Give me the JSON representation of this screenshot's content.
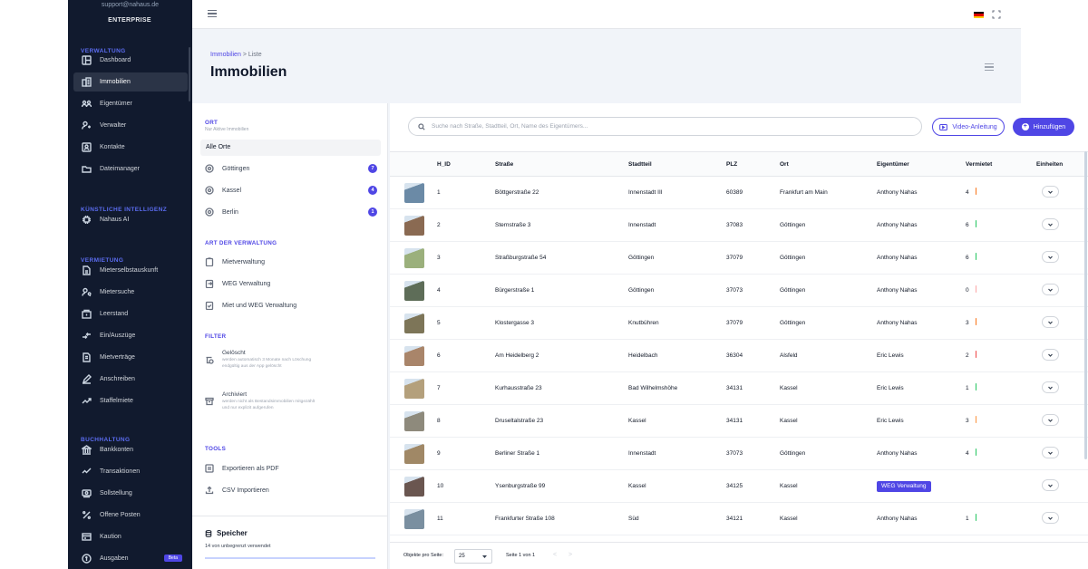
{
  "sidebar": {
    "email": "support@nahaus.de",
    "plan": "ENTERPRISE",
    "sections": [
      {
        "key": "verwaltung",
        "label": "VERWALTUNG"
      },
      {
        "key": "ki",
        "label": "KÜNSTLICHE INTELLIGENZ"
      },
      {
        "key": "vermietung",
        "label": "VERMIETUNG"
      },
      {
        "key": "buchhaltung",
        "label": "BUCHHALTUNG"
      }
    ],
    "items": [
      {
        "label": "Dashboard",
        "icon": "dashboard-icon"
      },
      {
        "label": "Immobilien",
        "icon": "building-icon",
        "active": true
      },
      {
        "label": "Eigentümer",
        "icon": "owners-icon"
      },
      {
        "label": "Verwalter",
        "icon": "managers-icon"
      },
      {
        "label": "Kontakte",
        "icon": "contacts-icon"
      },
      {
        "label": "Dateimanager",
        "icon": "folder-icon"
      },
      {
        "label": "Nahaus AI",
        "icon": "ai-chip-icon"
      },
      {
        "label": "Mieterselbstauskunft",
        "icon": "document-icon"
      },
      {
        "label": "Mietersuche",
        "icon": "tenant-search-icon"
      },
      {
        "label": "Leerstand",
        "icon": "vacancy-icon"
      },
      {
        "label": "Ein/Auszüge",
        "icon": "move-icon"
      },
      {
        "label": "Mietverträge",
        "icon": "contract-icon"
      },
      {
        "label": "Anschreiben",
        "icon": "pen-icon"
      },
      {
        "label": "Staffelmiete",
        "icon": "trend-icon"
      },
      {
        "label": "Bankkonten",
        "icon": "bank-icon"
      },
      {
        "label": "Transaktionen",
        "icon": "transactions-icon"
      },
      {
        "label": "Sollstellung",
        "icon": "cash-icon"
      },
      {
        "label": "Offene Posten",
        "icon": "percent-icon"
      },
      {
        "label": "Kaution",
        "icon": "deposit-icon"
      },
      {
        "label": "Ausgaben",
        "icon": "expenses-icon",
        "badge": "Beta"
      }
    ]
  },
  "topbar": {
    "language": "de"
  },
  "header": {
    "breadcrumb_root": "Immobilien",
    "breadcrumb_sep": ">",
    "breadcrumb_current": "Liste",
    "title": "Immobilien"
  },
  "filters": {
    "ort_title": "ORT",
    "ort_sub": "Nur Aktive Immobilien",
    "all_locations": "Alle Orte",
    "locations": [
      {
        "name": "Göttingen",
        "count": "7"
      },
      {
        "name": "Kassel",
        "count": "4"
      },
      {
        "name": "Berlin",
        "count": "1"
      }
    ],
    "art_title": "ART DER VERWALTUNG",
    "art_items": [
      "Mietverwaltung",
      "WEG Verwaltung",
      "Miet und WEG Verwaltung"
    ],
    "filter_title": "FILTER",
    "deleted_title": "Gelöscht",
    "deleted_desc": "werden automatisch 3 Monate nach Löschung endgültig aus der App gelöscht",
    "archived_title": "Archiviert",
    "archived_desc": "werden nicht als Bestandsimmobilien mitgezählt und nur explizit aufgerufen",
    "tools_title": "TOOLS",
    "tools": [
      "Exportieren als PDF",
      "CSV Importieren"
    ],
    "storage_title": "Speicher",
    "storage_sub": "14 von unbegrenzt verwendet"
  },
  "main": {
    "search_placeholder": "Suche nach Straße, Stadtteil, Ort, Name des Eigentümers...",
    "video_label": "Video-Anleitung",
    "add_label": "Hinzufügen",
    "columns": [
      "H_ID",
      "Straße",
      "Stadtteil",
      "PLZ",
      "Ort",
      "Eigentümer",
      "Vermietet",
      "Einheiten"
    ],
    "rows": [
      {
        "id": "1",
        "street": "Böttgerstraße 22",
        "district": "Innenstadt III",
        "plz": "60389",
        "city": "Frankfurt am Main",
        "owner": "Anthony Nahas",
        "rented": "4",
        "rented_color": "#f97316",
        "thumb": "#6b8aa6"
      },
      {
        "id": "2",
        "street": "Sternstraße 3",
        "district": "Innenstadt",
        "plz": "37083",
        "city": "Göttingen",
        "owner": "Anthony Nahas",
        "rented": "6",
        "rented_color": "#22c55e",
        "thumb": "#8a6a52"
      },
      {
        "id": "3",
        "street": "Straßburgstraße 54",
        "district": "Göttingen",
        "plz": "37079",
        "city": "Göttingen",
        "owner": "Anthony Nahas",
        "rented": "6",
        "rented_color": "#22c55e",
        "thumb": "#9bb07c"
      },
      {
        "id": "4",
        "street": "Bürgerstraße 1",
        "district": "Göttingen",
        "plz": "37073",
        "city": "Göttingen",
        "owner": "Anthony Nahas",
        "rented": "0",
        "rented_color": "#fca5a5",
        "thumb": "#5e6d58"
      },
      {
        "id": "5",
        "street": "Klostergasse 3",
        "district": "Knutbühren",
        "plz": "37079",
        "city": "Göttingen",
        "owner": "Anthony Nahas",
        "rented": "3",
        "rented_color": "#f97316",
        "thumb": "#7d7558"
      },
      {
        "id": "6",
        "street": "Am Heidelberg 2",
        "district": "Heidelbach",
        "plz": "36304",
        "city": "Alsfeld",
        "owner": "Eric Lewis",
        "rented": "2",
        "rented_color": "#ef4444",
        "thumb": "#a9856a"
      },
      {
        "id": "7",
        "street": "Kurhausstraße 23",
        "district": "Bad Wilhelmshöhe",
        "plz": "34131",
        "city": "Kassel",
        "owner": "Eric Lewis",
        "rented": "1",
        "rented_color": "#22c55e",
        "thumb": "#b4a07c"
      },
      {
        "id": "8",
        "street": "Druseltalstraße 23",
        "district": "Kassel",
        "plz": "34131",
        "city": "Kassel",
        "owner": "Eric Lewis",
        "rented": "3",
        "rented_color": "#fb923c",
        "thumb": "#8e8a7c"
      },
      {
        "id": "9",
        "street": "Berliner Straße 1",
        "district": "Innenstadt",
        "plz": "37073",
        "city": "Göttingen",
        "owner": "Anthony Nahas",
        "rented": "4",
        "rented_color": "#22c55e",
        "thumb": "#a08866"
      },
      {
        "id": "10",
        "street": "Ysenburgstraße 99",
        "district": "Kassel",
        "plz": "34125",
        "city": "Kassel",
        "owner": "WEG Verwaltung",
        "owner_badge": true,
        "rented": "",
        "rented_color": "",
        "thumb": "#6a5650"
      },
      {
        "id": "11",
        "street": "Frankfurter Straße 108",
        "district": "Süd",
        "plz": "34121",
        "city": "Kassel",
        "owner": "Anthony Nahas",
        "rented": "1",
        "rented_color": "#22c55e",
        "thumb": "#7a8fa0"
      }
    ],
    "pager": {
      "label": "Objekte pro Seite:",
      "per_page": "25",
      "info": "Seite 1 von 1",
      "prev": "<",
      "next": ">"
    }
  }
}
